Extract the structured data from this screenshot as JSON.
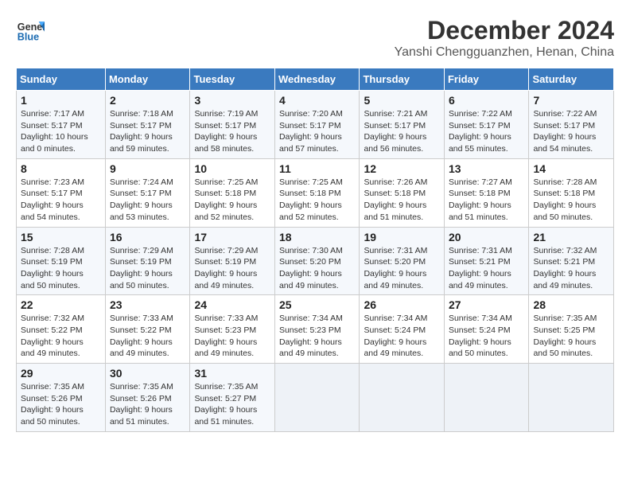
{
  "header": {
    "logo_line1": "General",
    "logo_line2": "Blue",
    "title": "December 2024",
    "subtitle": "Yanshi Chengguanzhen, Henan, China"
  },
  "days_of_week": [
    "Sunday",
    "Monday",
    "Tuesday",
    "Wednesday",
    "Thursday",
    "Friday",
    "Saturday"
  ],
  "weeks": [
    [
      {
        "day": 1,
        "info": "Sunrise: 7:17 AM\nSunset: 5:17 PM\nDaylight: 10 hours\nand 0 minutes."
      },
      {
        "day": 2,
        "info": "Sunrise: 7:18 AM\nSunset: 5:17 PM\nDaylight: 9 hours\nand 59 minutes."
      },
      {
        "day": 3,
        "info": "Sunrise: 7:19 AM\nSunset: 5:17 PM\nDaylight: 9 hours\nand 58 minutes."
      },
      {
        "day": 4,
        "info": "Sunrise: 7:20 AM\nSunset: 5:17 PM\nDaylight: 9 hours\nand 57 minutes."
      },
      {
        "day": 5,
        "info": "Sunrise: 7:21 AM\nSunset: 5:17 PM\nDaylight: 9 hours\nand 56 minutes."
      },
      {
        "day": 6,
        "info": "Sunrise: 7:22 AM\nSunset: 5:17 PM\nDaylight: 9 hours\nand 55 minutes."
      },
      {
        "day": 7,
        "info": "Sunrise: 7:22 AM\nSunset: 5:17 PM\nDaylight: 9 hours\nand 54 minutes."
      }
    ],
    [
      {
        "day": 8,
        "info": "Sunrise: 7:23 AM\nSunset: 5:17 PM\nDaylight: 9 hours\nand 54 minutes."
      },
      {
        "day": 9,
        "info": "Sunrise: 7:24 AM\nSunset: 5:17 PM\nDaylight: 9 hours\nand 53 minutes."
      },
      {
        "day": 10,
        "info": "Sunrise: 7:25 AM\nSunset: 5:18 PM\nDaylight: 9 hours\nand 52 minutes."
      },
      {
        "day": 11,
        "info": "Sunrise: 7:25 AM\nSunset: 5:18 PM\nDaylight: 9 hours\nand 52 minutes."
      },
      {
        "day": 12,
        "info": "Sunrise: 7:26 AM\nSunset: 5:18 PM\nDaylight: 9 hours\nand 51 minutes."
      },
      {
        "day": 13,
        "info": "Sunrise: 7:27 AM\nSunset: 5:18 PM\nDaylight: 9 hours\nand 51 minutes."
      },
      {
        "day": 14,
        "info": "Sunrise: 7:28 AM\nSunset: 5:18 PM\nDaylight: 9 hours\nand 50 minutes."
      }
    ],
    [
      {
        "day": 15,
        "info": "Sunrise: 7:28 AM\nSunset: 5:19 PM\nDaylight: 9 hours\nand 50 minutes."
      },
      {
        "day": 16,
        "info": "Sunrise: 7:29 AM\nSunset: 5:19 PM\nDaylight: 9 hours\nand 50 minutes."
      },
      {
        "day": 17,
        "info": "Sunrise: 7:29 AM\nSunset: 5:19 PM\nDaylight: 9 hours\nand 49 minutes."
      },
      {
        "day": 18,
        "info": "Sunrise: 7:30 AM\nSunset: 5:20 PM\nDaylight: 9 hours\nand 49 minutes."
      },
      {
        "day": 19,
        "info": "Sunrise: 7:31 AM\nSunset: 5:20 PM\nDaylight: 9 hours\nand 49 minutes."
      },
      {
        "day": 20,
        "info": "Sunrise: 7:31 AM\nSunset: 5:21 PM\nDaylight: 9 hours\nand 49 minutes."
      },
      {
        "day": 21,
        "info": "Sunrise: 7:32 AM\nSunset: 5:21 PM\nDaylight: 9 hours\nand 49 minutes."
      }
    ],
    [
      {
        "day": 22,
        "info": "Sunrise: 7:32 AM\nSunset: 5:22 PM\nDaylight: 9 hours\nand 49 minutes."
      },
      {
        "day": 23,
        "info": "Sunrise: 7:33 AM\nSunset: 5:22 PM\nDaylight: 9 hours\nand 49 minutes."
      },
      {
        "day": 24,
        "info": "Sunrise: 7:33 AM\nSunset: 5:23 PM\nDaylight: 9 hours\nand 49 minutes."
      },
      {
        "day": 25,
        "info": "Sunrise: 7:34 AM\nSunset: 5:23 PM\nDaylight: 9 hours\nand 49 minutes."
      },
      {
        "day": 26,
        "info": "Sunrise: 7:34 AM\nSunset: 5:24 PM\nDaylight: 9 hours\nand 49 minutes."
      },
      {
        "day": 27,
        "info": "Sunrise: 7:34 AM\nSunset: 5:24 PM\nDaylight: 9 hours\nand 50 minutes."
      },
      {
        "day": 28,
        "info": "Sunrise: 7:35 AM\nSunset: 5:25 PM\nDaylight: 9 hours\nand 50 minutes."
      }
    ],
    [
      {
        "day": 29,
        "info": "Sunrise: 7:35 AM\nSunset: 5:26 PM\nDaylight: 9 hours\nand 50 minutes."
      },
      {
        "day": 30,
        "info": "Sunrise: 7:35 AM\nSunset: 5:26 PM\nDaylight: 9 hours\nand 51 minutes."
      },
      {
        "day": 31,
        "info": "Sunrise: 7:35 AM\nSunset: 5:27 PM\nDaylight: 9 hours\nand 51 minutes."
      },
      null,
      null,
      null,
      null
    ]
  ]
}
